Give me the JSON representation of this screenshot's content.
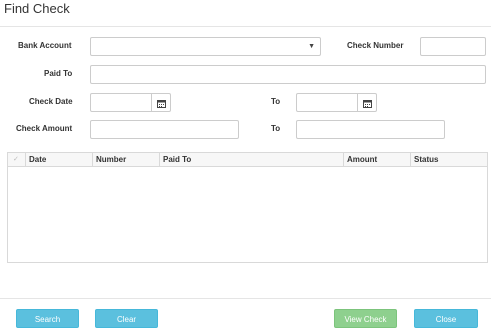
{
  "window": {
    "title": "Find Check"
  },
  "form": {
    "bank_account": {
      "label": "Bank Account",
      "value": ""
    },
    "check_number": {
      "label": "Check Number",
      "value": ""
    },
    "paid_to": {
      "label": "Paid To",
      "value": ""
    },
    "check_date": {
      "label": "Check Date",
      "value": "",
      "to_label": "To",
      "to_value": ""
    },
    "check_amount": {
      "label": "Check Amount",
      "value": "",
      "to_label": "To",
      "to_value": ""
    }
  },
  "grid": {
    "columns": [
      "Date",
      "Number",
      "Paid To",
      "Amount",
      "Status"
    ],
    "select_all_glyph": "✓",
    "rows": []
  },
  "buttons": {
    "search": "Search",
    "clear": "Clear",
    "view_check": "View Check",
    "close": "Close"
  },
  "colors": {
    "primary_button": "#5bc0de",
    "disabled_button": "#8ed08e"
  },
  "icons": {
    "calendar": "calendar-icon",
    "dropdown": "chevron-down-icon"
  }
}
